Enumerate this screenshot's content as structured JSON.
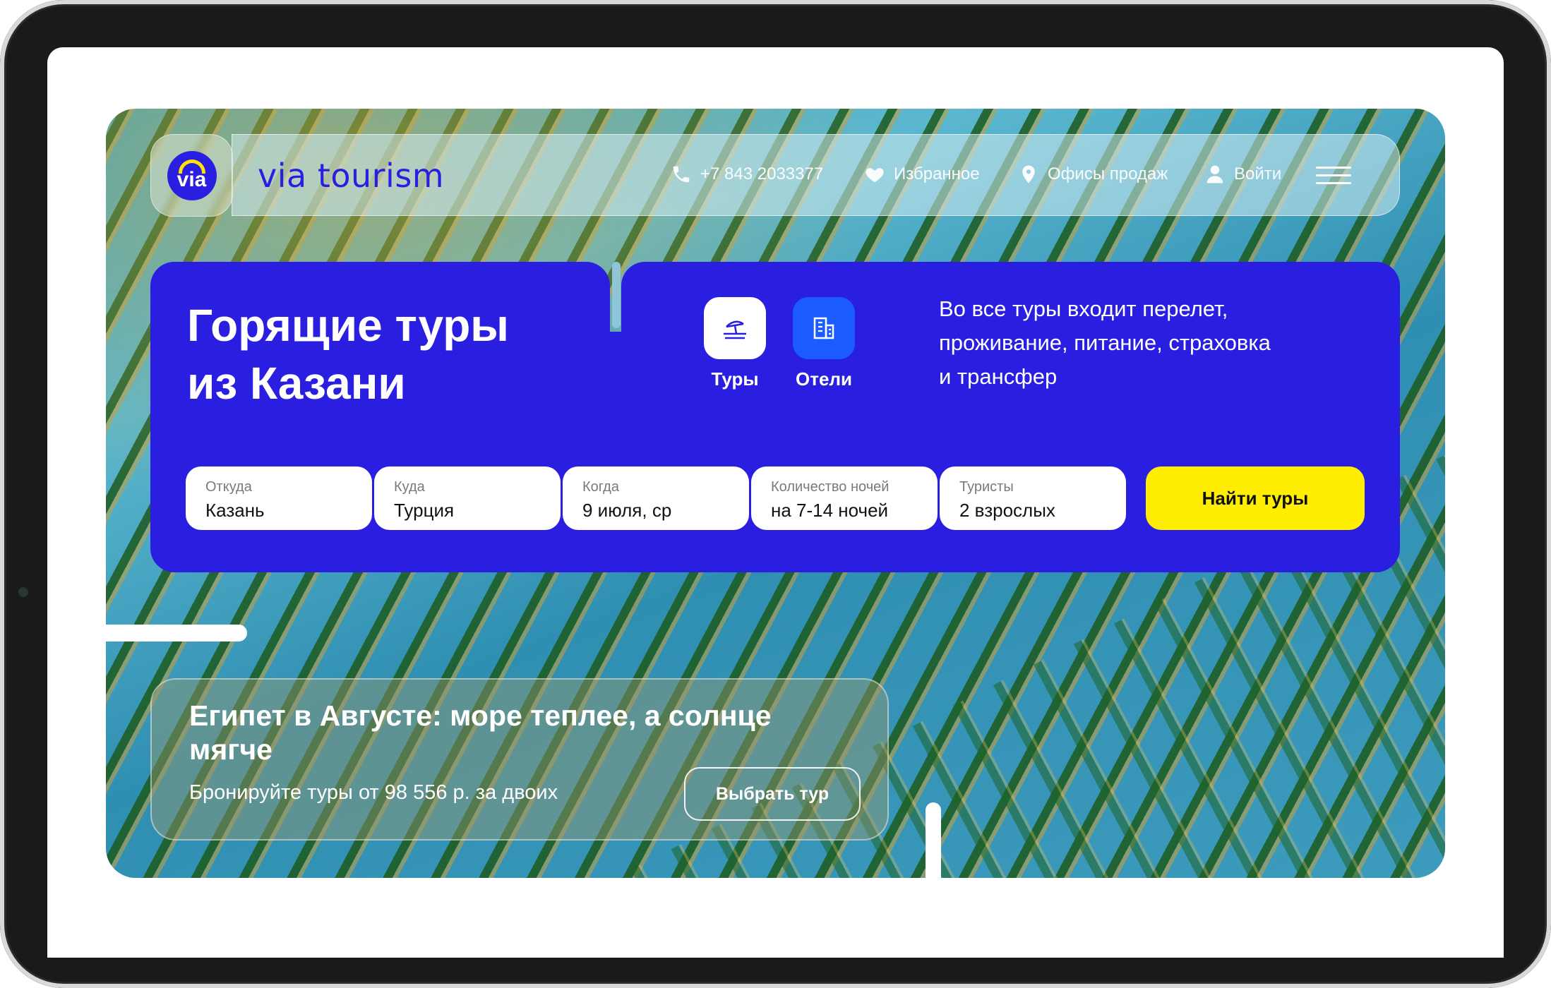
{
  "brand": {
    "logo_text": "via",
    "name": "via tourism"
  },
  "header": {
    "phone": "+7 843 2033377",
    "favorites": "Избранное",
    "offices": "Офисы продаж",
    "login": "Войти"
  },
  "hero": {
    "title_line1": "Горящие туры",
    "title_line2": "из Казани",
    "tabs": [
      {
        "label": "Туры",
        "icon": "beach-umbrella-icon"
      },
      {
        "label": "Отели",
        "icon": "building-icon"
      }
    ],
    "info_line1": "Во все туры входит перелет,",
    "info_line2": "проживание, питание, страховка",
    "info_line3": "и трансфер"
  },
  "search": {
    "fields": [
      {
        "label": "Откуда",
        "value": "Казань"
      },
      {
        "label": "Куда",
        "value": "Турция"
      },
      {
        "label": "Когда",
        "value": "9 июля, ср"
      },
      {
        "label": "Количество ночей",
        "value": "на 7-14 ночей"
      },
      {
        "label": "Туристы",
        "value": "2 взрослых"
      }
    ],
    "submit": "Найти туры"
  },
  "promo": {
    "title": "Египет в Августе: море теплее, а солнце мягче",
    "subtitle": "Бронируйте туры от 98 556 р. за двоих",
    "button": "Выбрать тур"
  },
  "colors": {
    "primary": "#2a1fe0",
    "accent": "#ffee00",
    "tab_active": "#ffffff",
    "tab_inactive": "#1a5cff"
  }
}
